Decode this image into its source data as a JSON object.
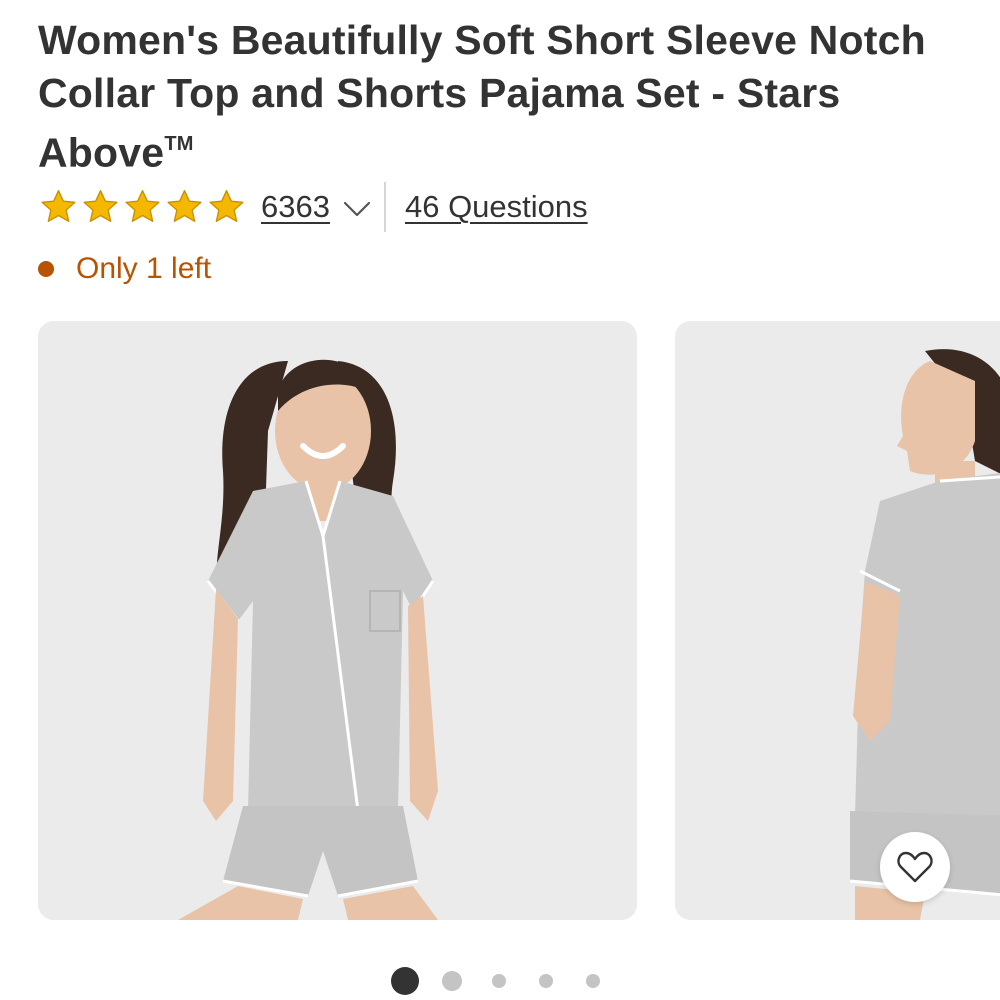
{
  "product": {
    "title": "Women's Beautifully Soft Short Sleeve Notch Collar Top and Shorts Pajama Set - Stars Above",
    "trademark": "TM",
    "rating": {
      "stars": 5,
      "max_stars": 5,
      "count": "6363",
      "star_color": "#f5b800"
    },
    "questions_link": "46 Questions",
    "stock": {
      "text": "Only 1 left",
      "color": "#b85300"
    }
  },
  "gallery": {
    "images": [
      {
        "name": "front view of woman wearing gray pajama top and shorts"
      },
      {
        "name": "side view of woman wearing gray pajama top and shorts"
      }
    ],
    "favorite_icon": "heart-icon",
    "pagination": {
      "total": 5,
      "active": 1
    }
  }
}
